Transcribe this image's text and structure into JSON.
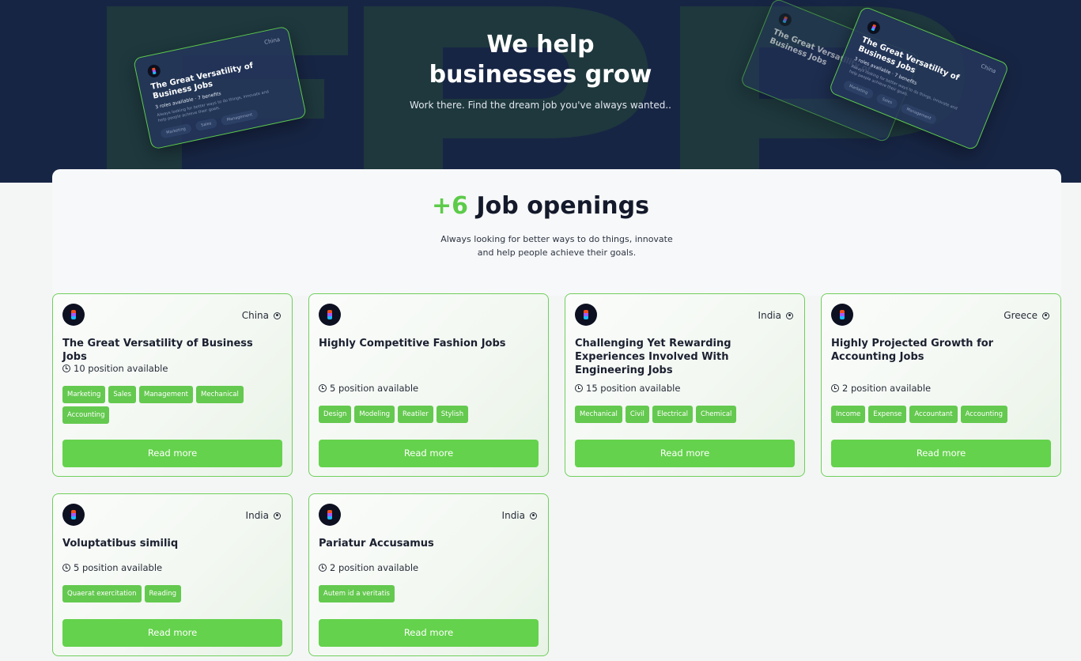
{
  "hero": {
    "title_line1": "We help",
    "title_line2": "businesses grow",
    "subtitle": "Work there. Find the dream job you've always wanted.."
  },
  "preview_card": {
    "location": "China",
    "title": "The Great Versatility of Business Jobs",
    "roles": "3 roles available",
    "benefits": "7 benefits",
    "description": "Always looking for better ways to do things, innovate and help people achieve their goals.",
    "tags": [
      "Marketing",
      "Sales",
      "Management"
    ]
  },
  "openings": {
    "count": "+6",
    "label": "Job openings",
    "subtitle_line1": "Always looking for better ways to do things, innovate",
    "subtitle_line2": "and help people achieve their goals."
  },
  "colors": {
    "accent": "#64d24c",
    "hero_bg": "#172544"
  },
  "jobs": [
    {
      "location": "China",
      "title": "The Great Versatility of Business Jobs",
      "positions": "10 position available",
      "tags": [
        "Marketing",
        "Sales",
        "Management",
        "Mechanical",
        "Accounting"
      ],
      "button": "Read more"
    },
    {
      "location": "",
      "title": "Highly Competitive Fashion Jobs",
      "positions": "5 position available",
      "tags": [
        "Design",
        "Modeling",
        "Reatiler",
        "Stylish"
      ],
      "button": "Read more"
    },
    {
      "location": "India",
      "title": "Challenging Yet Rewarding Experiences Involved With Engineering Jobs",
      "positions": "15 position available",
      "tags": [
        "Mechanical",
        "Civil",
        "Electrical",
        "Chemical"
      ],
      "button": "Read more"
    },
    {
      "location": "Greece",
      "title": "Highly Projected Growth for Accounting Jobs",
      "positions": "2 position available",
      "tags": [
        "Income",
        "Expense",
        "Accountant",
        "Accounting"
      ],
      "button": "Read more"
    },
    {
      "location": "India",
      "title": "Voluptatibus similiq",
      "positions": "5 position available",
      "tags": [
        "Quaerat exercitation",
        "Reading"
      ],
      "button": "Read more"
    },
    {
      "location": "India",
      "title": "Pariatur Accusamus",
      "positions": "2 position available",
      "tags": [
        "Autem id a veritatis"
      ],
      "button": "Read more"
    }
  ]
}
